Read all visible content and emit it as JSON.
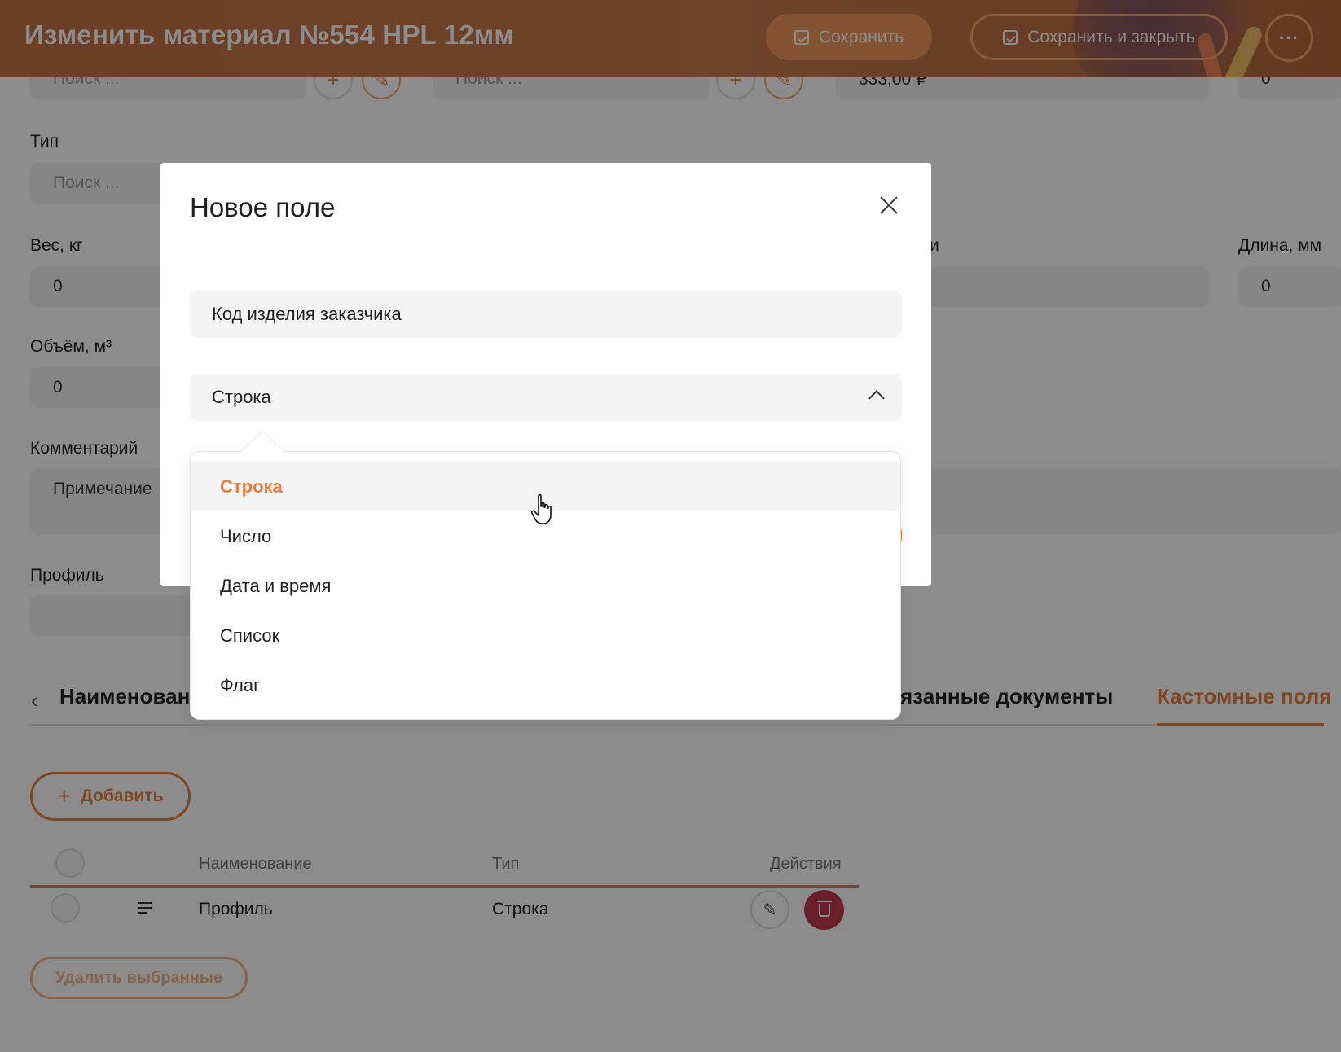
{
  "header": {
    "title": "Изменить материал №554 HPL 12мм",
    "save_label": "Сохранить",
    "save_close_label": "Сохранить и закрыть",
    "more_label": "···"
  },
  "form": {
    "search_placeholder": "Поиск ...",
    "price_value": "333,00 ₽",
    "top_right_value": "0",
    "type_label": "Тип",
    "weight_label": "Вес, кг",
    "weight_value": "0",
    "partial_label": "и",
    "length_label": "Длина, мм",
    "length_value": "0",
    "volume_label": "Объём, м³",
    "volume_value": "0",
    "comment_label": "Комментарий",
    "comment_value": "Примечание",
    "profile_label": "Профиль"
  },
  "tabs": {
    "first": "Наименовани",
    "linked_partial": "язанные документы",
    "custom_fields": "Кастомные поля"
  },
  "custom_fields": {
    "add_label": "Добавить",
    "columns": {
      "name": "Наименование",
      "type": "Тип",
      "actions": "Действия"
    },
    "rows": [
      {
        "name": "Профиль",
        "type": "Строка"
      }
    ],
    "delete_selected_label": "Удалить выбранные"
  },
  "modal": {
    "title": "Новое поле",
    "name_value": "Код изделия заказчика",
    "type_value": "Строка",
    "options": [
      "Строка",
      "Число",
      "Дата и время",
      "Список",
      "Флаг"
    ],
    "selected_option": "Строка"
  },
  "colors": {
    "accent": "#e7803e",
    "header_bg": "#c57544",
    "danger": "#c43b4b"
  }
}
